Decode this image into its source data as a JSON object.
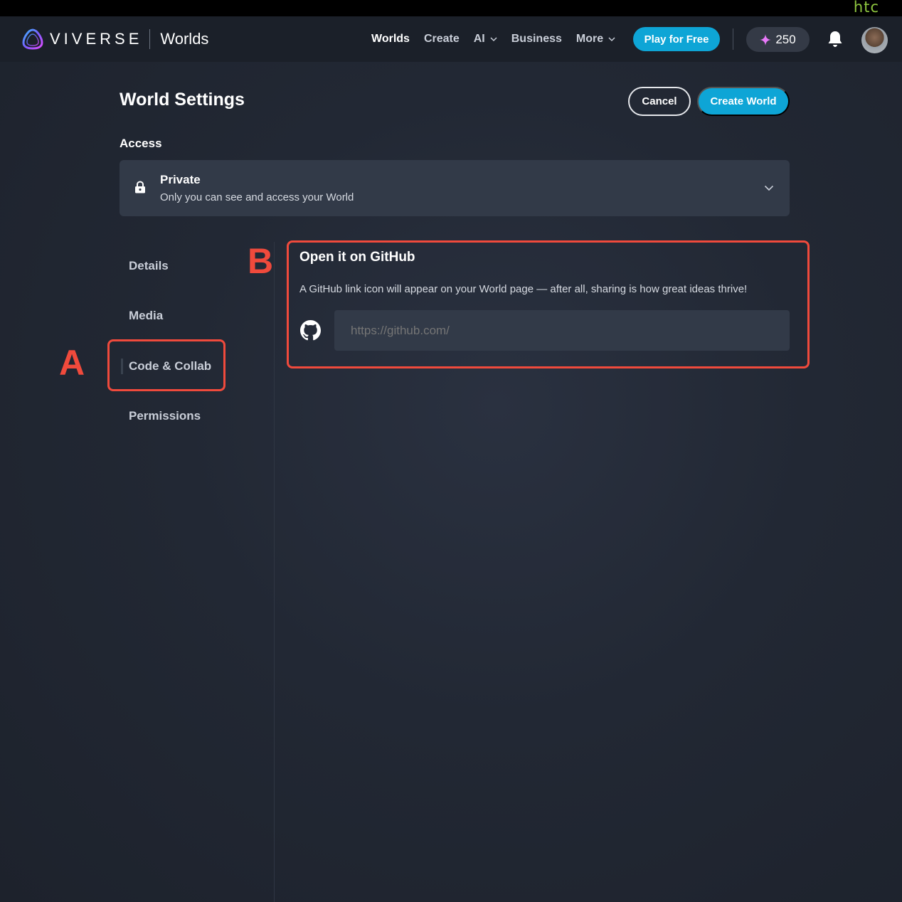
{
  "system": {
    "vendor_logo": "htc"
  },
  "nav": {
    "brand_name": "VIVERSE",
    "brand_product": "Worlds",
    "links": [
      {
        "label": "Worlds",
        "active": true,
        "dropdown": false
      },
      {
        "label": "Create",
        "active": false,
        "dropdown": false
      },
      {
        "label": "AI",
        "active": false,
        "dropdown": true
      },
      {
        "label": "Business",
        "active": false,
        "dropdown": false
      },
      {
        "label": "More",
        "active": false,
        "dropdown": true
      }
    ],
    "play_label": "Play for Free",
    "credits": "250",
    "icons": {
      "credits": "sparkle-icon",
      "notifications": "bell-icon",
      "profile": "avatar"
    }
  },
  "page": {
    "title": "World Settings",
    "cancel_label": "Cancel",
    "create_label": "Create World"
  },
  "access": {
    "label": "Access",
    "value_title": "Private",
    "value_desc": "Only you can see and access your World",
    "icon": "lock-icon"
  },
  "sidenav": {
    "items": [
      {
        "label": "Details",
        "active": false
      },
      {
        "label": "Media",
        "active": false
      },
      {
        "label": "Code & Collab",
        "active": true
      },
      {
        "label": "Permissions",
        "active": false
      }
    ]
  },
  "github": {
    "title": "Open it on GitHub",
    "description": "A GitHub link icon will appear on your World page — after all, sharing is how great ideas thrive!",
    "placeholder": "https://github.com/",
    "value": "",
    "icon": "github-icon"
  },
  "annotations": {
    "a": "A",
    "b": "B"
  },
  "colors": {
    "accent": "#0ea5d6",
    "background": "#222834",
    "navbar": "#1b2029",
    "field": "#323a48",
    "annotation": "#f04a3c",
    "htc_green": "#8ec63f"
  }
}
